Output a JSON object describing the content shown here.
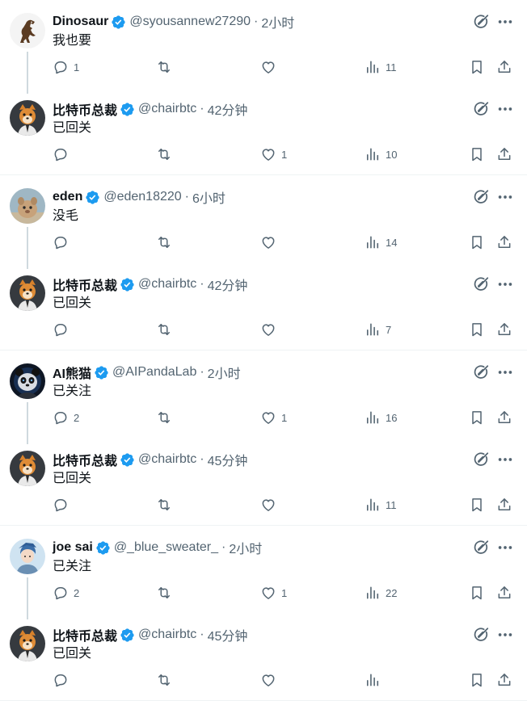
{
  "threads": [
    {
      "parent": {
        "name": "Dinosaur",
        "handle": "@syousannew27290",
        "sep": "·",
        "time": "2小时",
        "text": "我也要",
        "avatar": "dinosaur-avatar",
        "stats": {
          "replies": "1",
          "retweets": "",
          "likes": "",
          "views": "11"
        }
      },
      "reply": {
        "name": "比特币总裁",
        "handle": "@chairbtc",
        "sep": "·",
        "time": "42分钟",
        "text": "已回关",
        "avatar": "shiba-avatar",
        "stats": {
          "replies": "",
          "retweets": "",
          "likes": "1",
          "views": "10"
        }
      }
    },
    {
      "parent": {
        "name": "eden",
        "handle": "@eden18220",
        "sep": "·",
        "time": "6小时",
        "text": "没毛",
        "avatar": "pet-avatar",
        "stats": {
          "replies": "",
          "retweets": "",
          "likes": "",
          "views": "14"
        }
      },
      "reply": {
        "name": "比特币总裁",
        "handle": "@chairbtc",
        "sep": "·",
        "time": "42分钟",
        "text": "已回关",
        "avatar": "shiba-avatar",
        "stats": {
          "replies": "",
          "retweets": "",
          "likes": "",
          "views": "7"
        }
      }
    },
    {
      "parent": {
        "name": "AI熊猫",
        "handle": "@AIPandaLab",
        "sep": "·",
        "time": "2小时",
        "text": "已关注",
        "avatar": "panda-avatar",
        "stats": {
          "replies": "2",
          "retweets": "",
          "likes": "1",
          "views": "16"
        }
      },
      "reply": {
        "name": "比特币总裁",
        "handle": "@chairbtc",
        "sep": "·",
        "time": "45分钟",
        "text": "已回关",
        "avatar": "shiba-avatar",
        "stats": {
          "replies": "",
          "retweets": "",
          "likes": "",
          "views": "11"
        }
      }
    },
    {
      "parent": {
        "name": "joe sai",
        "handle": "@_blue_sweater_",
        "sep": "·",
        "time": "2小时",
        "text": "已关注",
        "avatar": "anime-avatar",
        "stats": {
          "replies": "2",
          "retweets": "",
          "likes": "1",
          "views": "22"
        }
      },
      "reply": {
        "name": "比特币总裁",
        "handle": "@chairbtc",
        "sep": "·",
        "time": "45分钟",
        "text": "已回关",
        "avatar": "shiba-avatar",
        "stats": {
          "replies": "",
          "retweets": "",
          "likes": "",
          "views": ""
        }
      }
    }
  ],
  "colors": {
    "text": "#0f1419",
    "secondary": "#536471",
    "verified": "#1d9bf0",
    "divider": "#eff3f4",
    "connector": "#cfd9de"
  }
}
